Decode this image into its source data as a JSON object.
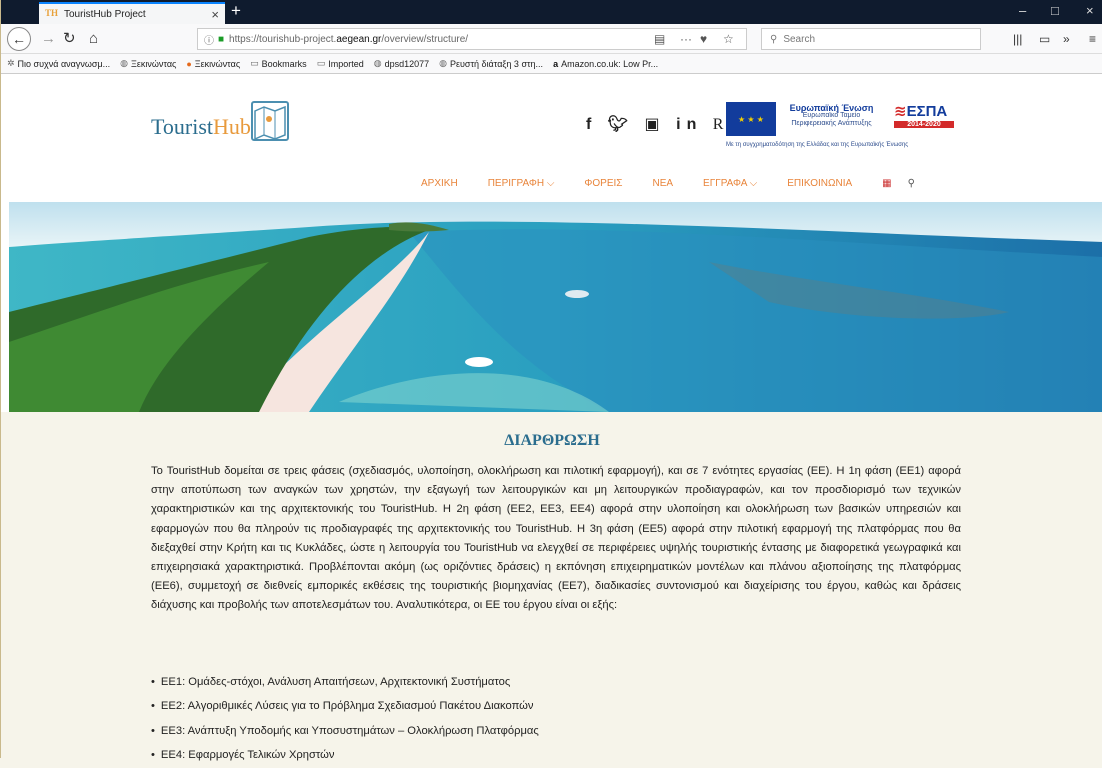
{
  "browser": {
    "tab_title": "TouristHub Project",
    "tab_favicon": "TH",
    "url_prefix": "https://tourishub-project.",
    "url_domain": "aegean.gr",
    "url_path": "/overview/structure/",
    "search_placeholder": "Search",
    "bookmarks": [
      {
        "label": "Πιο συχνά αναγνωσμ...",
        "icon": "gear-icon"
      },
      {
        "label": "Ξεκινώντας",
        "icon": "globe-icon"
      },
      {
        "label": "Ξεκινώντας",
        "icon": "firefox-icon"
      },
      {
        "label": "Bookmarks",
        "icon": "folder-icon"
      },
      {
        "label": "Imported",
        "icon": "folder-icon"
      },
      {
        "label": "dpsd12077",
        "icon": "globe-icon"
      },
      {
        "label": "Ρευστή διάταξη 3 στη...",
        "icon": "globe-icon"
      },
      {
        "label": "Amazon.co.uk: Low Pr...",
        "icon": "amazon-icon"
      }
    ]
  },
  "header": {
    "logo_main": "Tourist",
    "logo_accent": "Hub",
    "social": "f  •  in Rᴳ",
    "eu_title": "Ευρωπαϊκή Ένωση",
    "eu_sub": "Ευρωπαϊκό Ταμείο Περιφερειακής Ανάπτυξης",
    "espa": "ΕΣΠΑ",
    "espa_years": "2014-2020",
    "eu_footer": "Με τη συγχρηματοδότηση της Ελλάδας και της Ευρωπαϊκής Ένωσης"
  },
  "menu": [
    {
      "label": "ΑΡΧΙΚΗ"
    },
    {
      "label": "ΠΕΡΙΓΡΑΦΗ ⌵"
    },
    {
      "label": "ΦΟΡΕΙΣ"
    },
    {
      "label": "ΝΕΑ"
    },
    {
      "label": "ΕΓΓΡΑΦΑ ⌵"
    },
    {
      "label": "ΕΠΙΚΟΙΝΩΝΙΑ"
    }
  ],
  "content": {
    "title": "ΔΙΑΡΘΡΩΣΗ",
    "paragraph": "Το TouristHub δομείται σε τρεις φάσεις (σχεδιασμός, υλοποίηση, ολοκλήρωση και πιλοτική εφαρμογή), και σε 7 ενότητες εργασίας (ΕΕ). Η 1η φάση (ΕΕ1) αφορά στην αποτύπωση των αναγκών των χρηστών, την εξαγωγή των λειτουργικών και μη λειτουργικών προδιαγραφών, και τον προσδιορισμό των τεχνικών χαρακτηριστικών και της αρχιτεκτονικής του TouristHub. Η 2η φάση (ΕΕ2, ΕΕ3, ΕΕ4) αφορά στην υλοποίηση και ολοκλήρωση των βασικών υπηρεσιών και εφαρμογών που θα πληρούν τις προδιαγραφές της αρχιτεκτονικής του TouristHub. Η 3η φάση (ΕΕ5) αφορά στην πιλοτική εφαρμογή της πλατφόρμας που θα διεξαχθεί στην Κρήτη και τις Κυκλάδες, ώστε η λειτουργία του TouristHub να ελεγχθεί σε περιφέρειες υψηλής τουριστικής έντασης με διαφορετικά γεωγραφικά και επιχειρησιακά χαρακτηριστικά. Προβλέπονται ακόμη (ως οριζόντιες δράσεις) η εκπόνηση επιχειρηματικών μοντέλων και πλάνου αξιοποίησης της πλατφόρμας (ΕΕ6), συμμετοχή σε διεθνείς εμπορικές εκθέσεις της τουριστικής βιομηχανίας (ΕΕ7), διαδικασίες συντονισμού και διαχείρισης του έργου, καθώς και δράσεις διάχυσης και προβολής των αποτελεσμάτων του. Αναλυτικότερα, οι ΕΕ του έργου είναι οι εξής:",
    "items": [
      "ΕΕ1: Ομάδες-στόχοι, Ανάλυση Απαιτήσεων, Αρχιτεκτονική Συστήματος",
      "ΕΕ2: Αλγοριθμικές Λύσεις για το Πρόβλημα Σχεδιασμού Πακέτου Διακοπών",
      "ΕΕ3: Ανάπτυξη Υποδομής και Υποσυστημάτων – Ολοκλήρωση Πλατφόρμας",
      "ΕΕ4: Εφαρμογές Τελικών Χρηστών"
    ]
  }
}
